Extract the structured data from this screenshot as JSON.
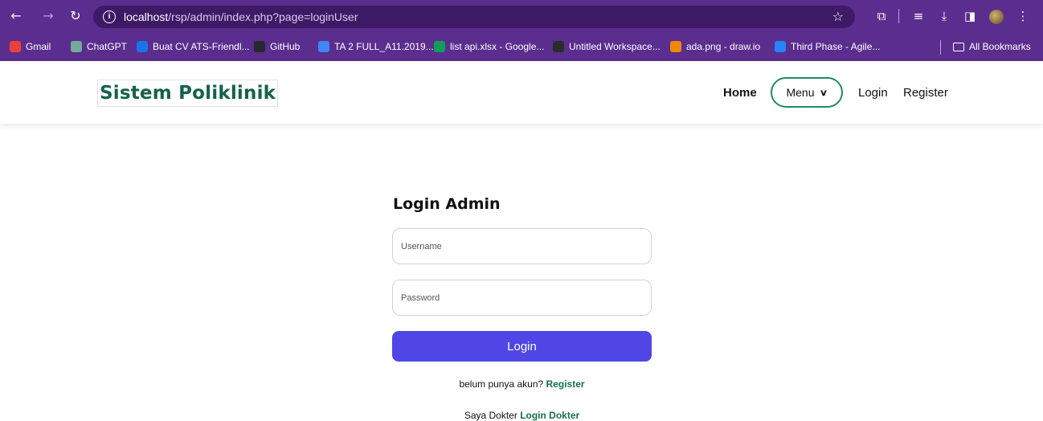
{
  "browser": {
    "url_host": "localhost",
    "url_path": "/rsp/admin/index.php?page=loginUser",
    "icons": [
      "back-icon",
      "forward-icon",
      "reload-icon",
      "info-icon",
      "star-icon",
      "extensions-icon",
      "reading-list-icon",
      "download-icon",
      "sidepanel-icon",
      "profile-avatar",
      "more-icon"
    ],
    "bookmarks": [
      {
        "label": "Gmail",
        "color": "#ea4335"
      },
      {
        "label": "ChatGPT",
        "color": "#74aa9c"
      },
      {
        "label": "Buat CV ATS-Friendl...",
        "color": "#1a73e8"
      },
      {
        "label": "GitHub",
        "color": "#24292f"
      },
      {
        "label": "TA 2 FULL_A11.2019...",
        "color": "#4285f4"
      },
      {
        "label": "list api.xlsx - Google...",
        "color": "#0f9d58"
      },
      {
        "label": "Untitled Workspace...",
        "color": "#2b2b2b"
      },
      {
        "label": "ada.png - draw.io",
        "color": "#f08705"
      },
      {
        "label": "Third Phase - Agile...",
        "color": "#2684ff"
      }
    ],
    "all_bookmarks": "All Bookmarks"
  },
  "navbar": {
    "brand": "Sistem Poliklinik",
    "home": "Home",
    "menu": "Menu",
    "login": "Login",
    "register": "Register",
    "accent": "#1f8a6a"
  },
  "form": {
    "title": "Login Admin",
    "username_placeholder": "Username",
    "password_placeholder": "Password",
    "submit": "Login",
    "button_color": "#4f46e5",
    "register_prompt": "belum punya akun?",
    "register_link": "Register",
    "doctor_prompt": "Saya Dokter",
    "doctor_link": "Login Dokter"
  }
}
